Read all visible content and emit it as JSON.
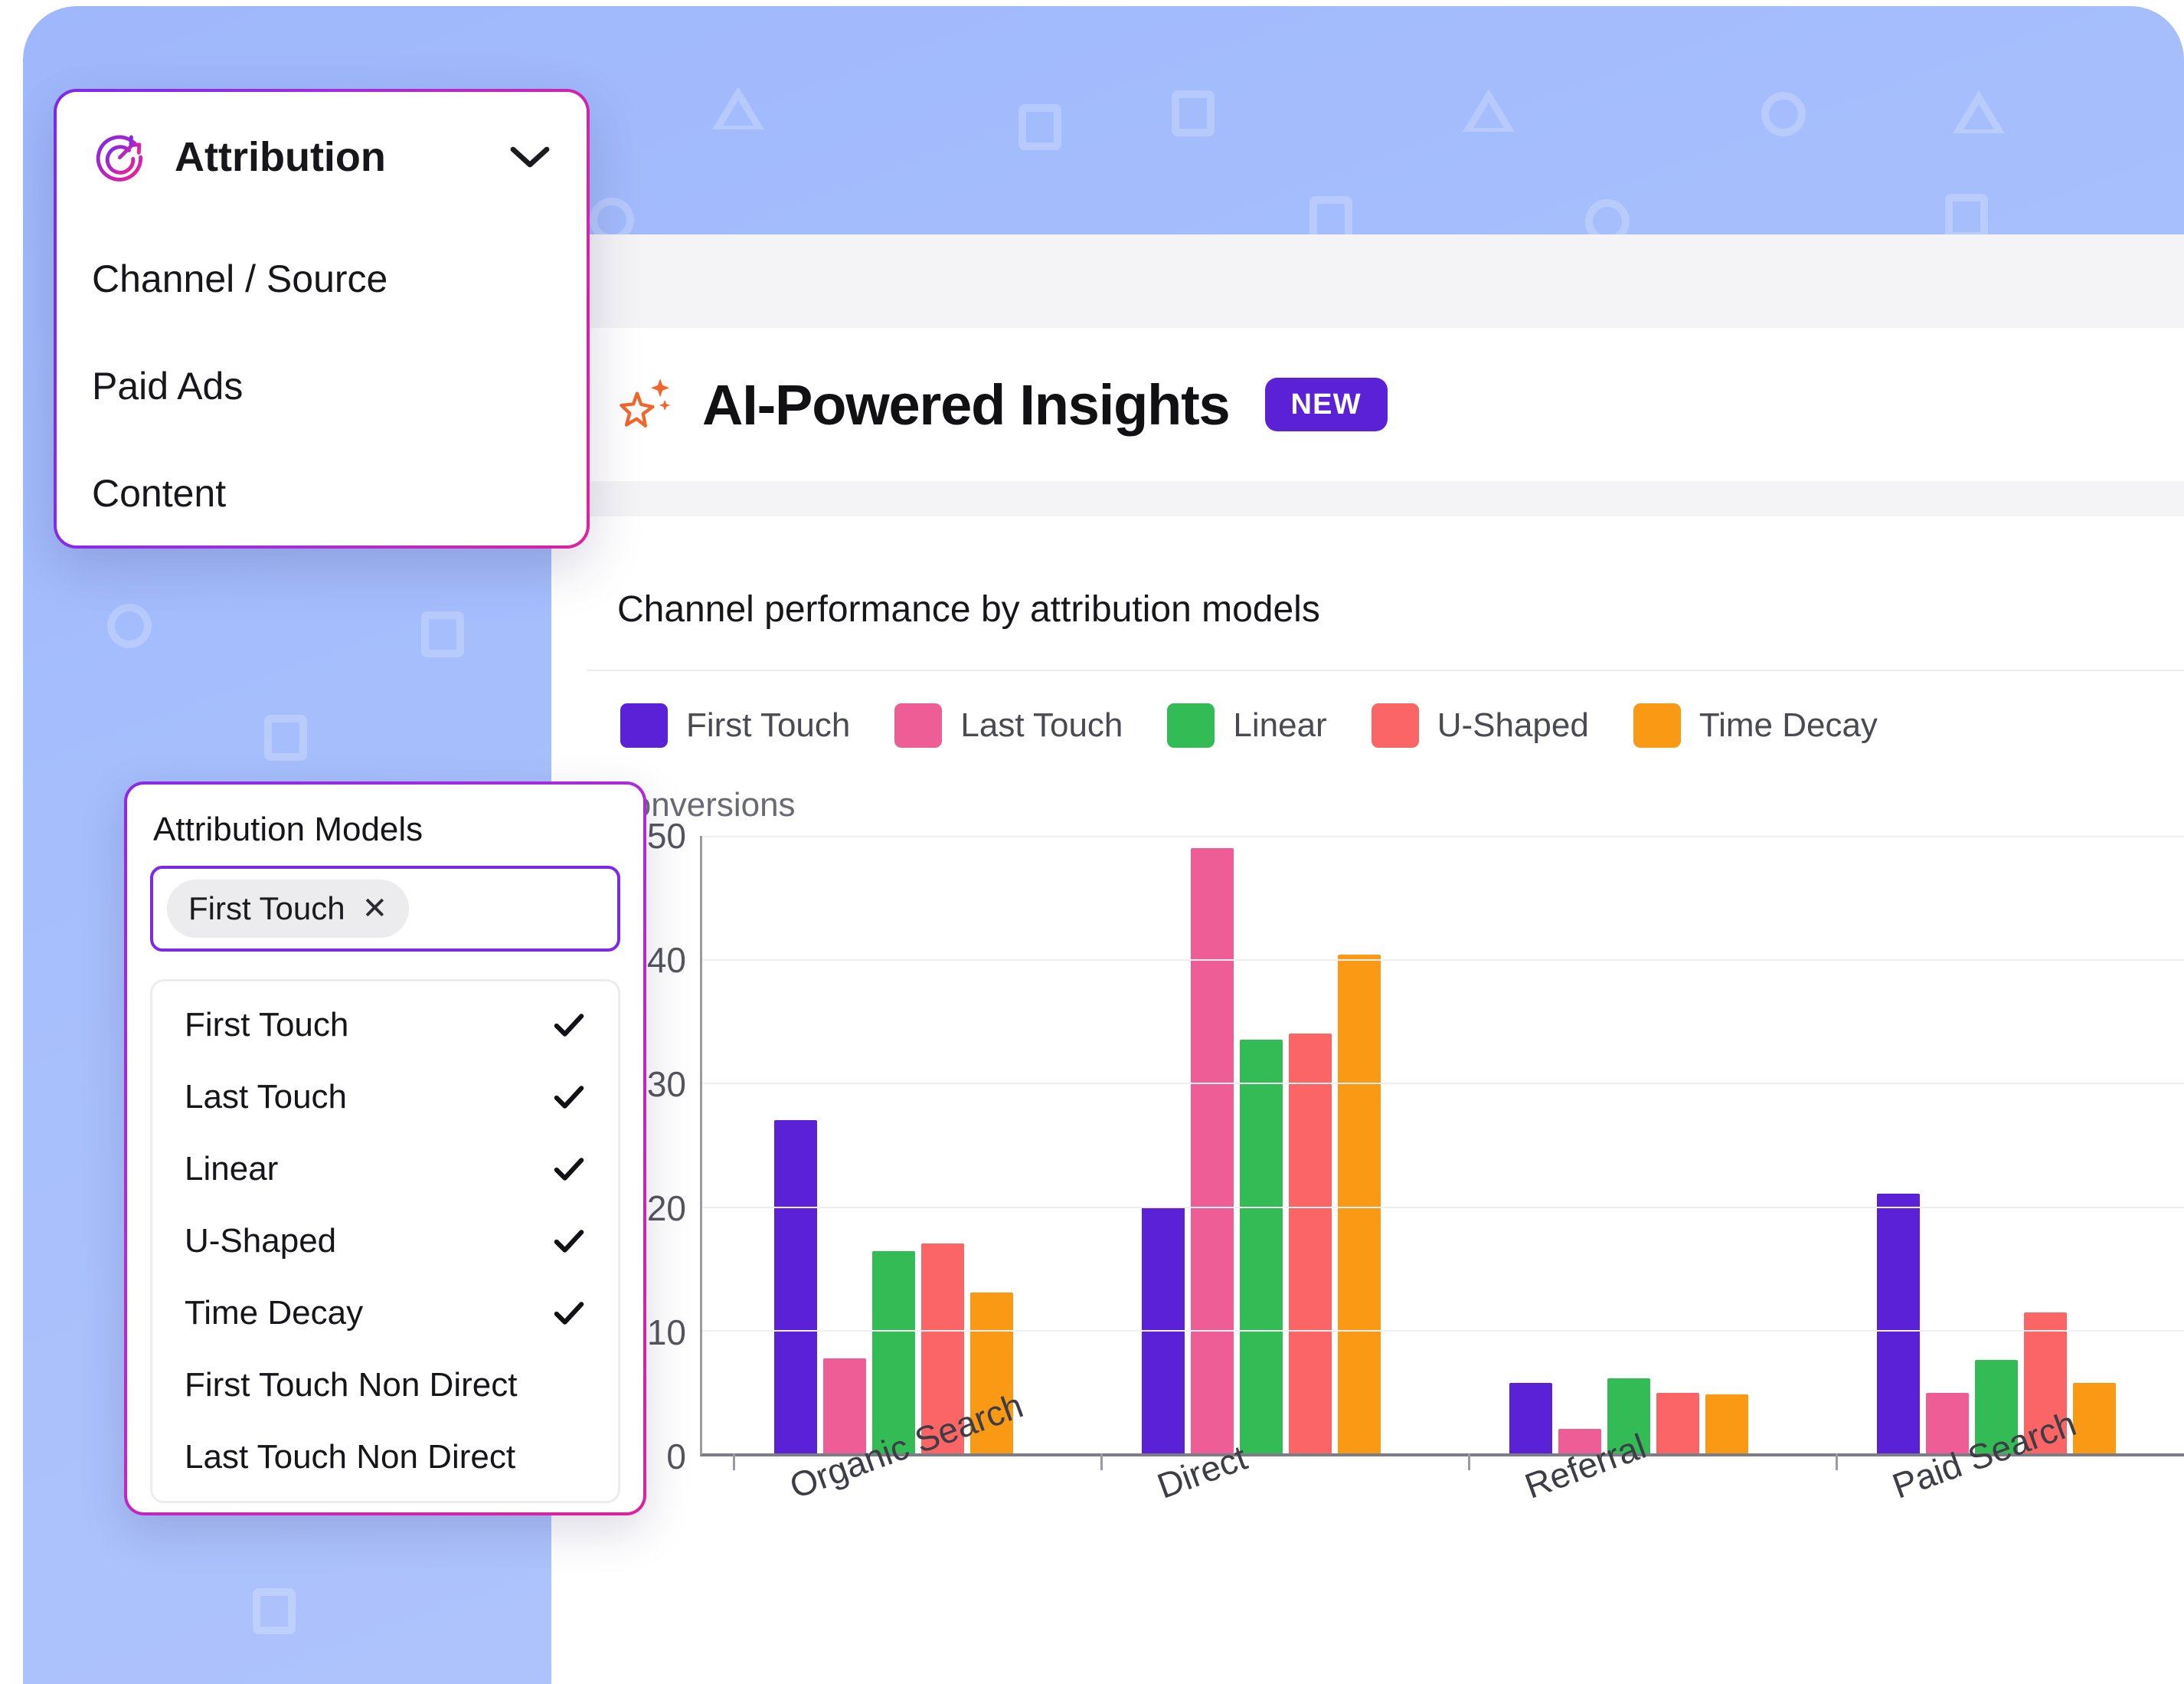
{
  "attribution_menu": {
    "icon": "target-icon",
    "title": "Attribution",
    "chevron": "chevron-down-icon",
    "options": [
      "Channel / Source",
      "Paid Ads",
      "Content"
    ]
  },
  "models_panel": {
    "heading": "Attribution Models",
    "selected_chips": [
      {
        "label": "First Touch",
        "remove": "✕"
      }
    ],
    "options": [
      {
        "label": "First Touch",
        "checked": true
      },
      {
        "label": "Last Touch",
        "checked": true
      },
      {
        "label": "Linear",
        "checked": true
      },
      {
        "label": "U-Shaped",
        "checked": true
      },
      {
        "label": "Time Decay",
        "checked": true
      },
      {
        "label": "First Touch Non Direct",
        "checked": false
      },
      {
        "label": "Last Touch Non Direct",
        "checked": false
      }
    ]
  },
  "header": {
    "icon": "sparkle-icon",
    "title": "AI-Powered Insights",
    "badge": "NEW",
    "badge_color": "#5b21d6"
  },
  "chart_data": {
    "type": "bar",
    "title": "Channel performance by attribution models",
    "xlabel": "",
    "ylabel": "Conversions",
    "ylim": [
      0,
      50
    ],
    "yticks": [
      0,
      10,
      20,
      30,
      40,
      50
    ],
    "grid": true,
    "legend_position": "top",
    "categories": [
      "Organic Search",
      "Direct",
      "Referral",
      "Paid Search"
    ],
    "series": [
      {
        "name": "First Touch",
        "color": "#5b21d6",
        "values": [
          27,
          20,
          5.7,
          21
        ]
      },
      {
        "name": "Last Touch",
        "color": "#ef5d96",
        "values": [
          7.7,
          49,
          2,
          4.9
        ]
      },
      {
        "name": "Linear",
        "color": "#33bb55",
        "values": [
          16.4,
          33.5,
          6.1,
          7.6
        ]
      },
      {
        "name": "U-Shaped",
        "color": "#fc6565",
        "values": [
          17,
          34,
          4.9,
          11.4
        ]
      },
      {
        "name": "Time Decay",
        "color": "#fa9a14",
        "values": [
          13,
          40.4,
          4.8,
          5.7
        ]
      }
    ]
  }
}
